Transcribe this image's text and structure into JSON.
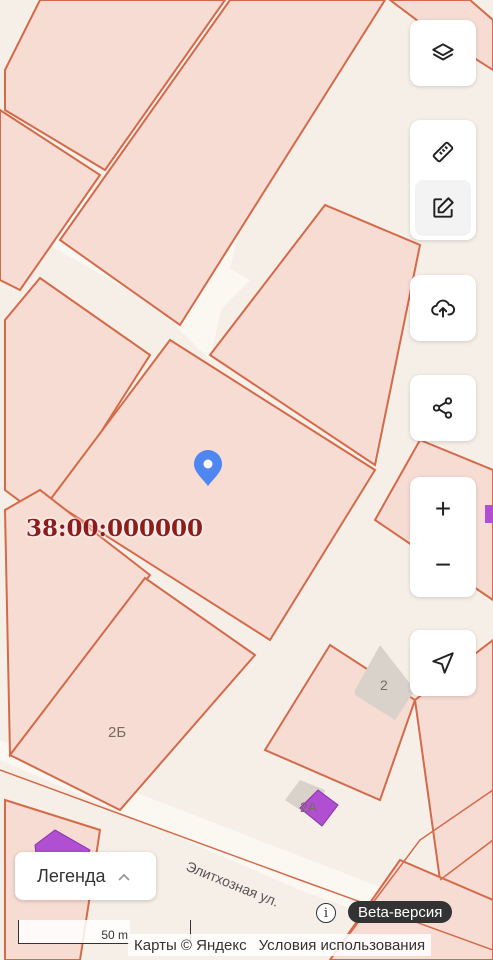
{
  "map": {
    "cadastral_number": "38:00:000000",
    "street_name": "Элитхозная ул.",
    "parcel_labels": [
      "2Б",
      "2",
      "2А"
    ],
    "colors": {
      "background": "#f6efe8",
      "parcel_fill": "#f6dcd3",
      "parcel_stroke": "#d36a4a",
      "road": "#fbf7f1",
      "building": "#d9d2cb",
      "highlight_building": "#b04fd1",
      "marker": "#4f86f2"
    }
  },
  "controls": {
    "layers": {
      "icon": "layers-icon"
    },
    "ruler": {
      "icon": "ruler-icon"
    },
    "edit": {
      "icon": "edit-icon"
    },
    "upload": {
      "icon": "cloud-upload-icon"
    },
    "share": {
      "icon": "share-icon"
    },
    "zoom_in": {
      "label": "+"
    },
    "zoom_out": {
      "label": "−"
    },
    "locate": {
      "icon": "navigation-arrow-icon"
    }
  },
  "legend": {
    "label": "Легенда"
  },
  "scale": {
    "label": "50 m"
  },
  "attribution": {
    "maps": "Карты © Яндекс",
    "terms": "Условия использования"
  },
  "beta": {
    "label": "Beta-версия",
    "info": "i"
  }
}
